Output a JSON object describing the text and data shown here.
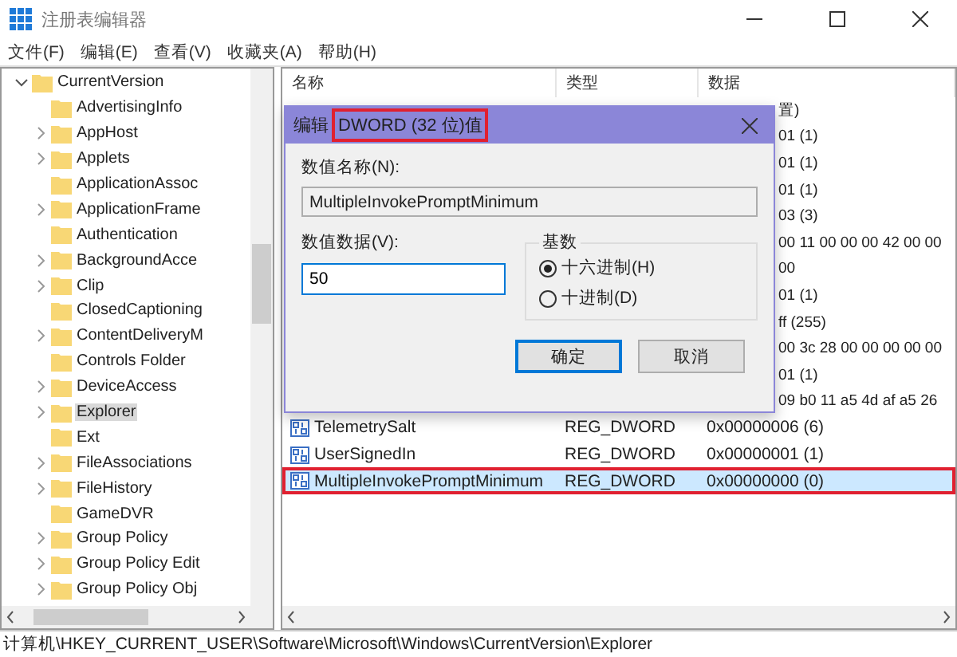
{
  "window": {
    "title": "注册表编辑器"
  },
  "menu": [
    "文件(F)",
    "编辑(E)",
    "查看(V)",
    "收藏夹(A)",
    "帮助(H)"
  ],
  "tree": {
    "label": "CurrentVersion",
    "expanded": true,
    "children": [
      {
        "label": "AdvertisingInfo",
        "has_children": false,
        "selected": false
      },
      {
        "label": "AppHost",
        "has_children": true,
        "selected": false
      },
      {
        "label": "Applets",
        "has_children": true,
        "selected": false
      },
      {
        "label": "ApplicationAssoc",
        "has_children": false,
        "selected": false
      },
      {
        "label": "ApplicationFrame",
        "has_children": true,
        "selected": false
      },
      {
        "label": "Authentication",
        "has_children": false,
        "selected": false
      },
      {
        "label": "BackgroundAcce",
        "has_children": true,
        "selected": false
      },
      {
        "label": "Clip",
        "has_children": true,
        "selected": false
      },
      {
        "label": "ClosedCaptioning",
        "has_children": false,
        "selected": false
      },
      {
        "label": "ContentDeliveryM",
        "has_children": true,
        "selected": false
      },
      {
        "label": "Controls Folder",
        "has_children": false,
        "selected": false
      },
      {
        "label": "DeviceAccess",
        "has_children": true,
        "selected": false
      },
      {
        "label": "Explorer",
        "has_children": true,
        "selected": true
      },
      {
        "label": "Ext",
        "has_children": false,
        "selected": false
      },
      {
        "label": "FileAssociations",
        "has_children": true,
        "selected": false
      },
      {
        "label": "FileHistory",
        "has_children": true,
        "selected": false
      },
      {
        "label": "GameDVR",
        "has_children": false,
        "selected": false
      },
      {
        "label": "Group Policy",
        "has_children": true,
        "selected": false
      },
      {
        "label": "Group Policy Edit",
        "has_children": true,
        "selected": false
      },
      {
        "label": "Group Policy Obj",
        "has_children": true,
        "selected": false
      }
    ]
  },
  "table": {
    "columns": [
      "名称",
      "类型",
      "数据"
    ],
    "rows": [
      {
        "kind": "covered",
        "data": "置)"
      },
      {
        "kind": "covered",
        "data": "01 (1)"
      },
      {
        "kind": "covered",
        "data": "01 (1)"
      },
      {
        "kind": "covered",
        "data": "01 (1)"
      },
      {
        "kind": "covered",
        "data": "03 (3)"
      },
      {
        "kind": "covered",
        "data": "00 11 00 00 00 42 00 00"
      },
      {
        "kind": "covered",
        "data": "00"
      },
      {
        "kind": "covered",
        "data": "01 (1)"
      },
      {
        "kind": "covered",
        "data": "ff (255)"
      },
      {
        "kind": "covered",
        "data": "00 3c 28 00 00 00 00 00"
      },
      {
        "kind": "covered",
        "data": "01 (1)"
      },
      {
        "kind": "covered",
        "data": "09 b0 11 a5 4d af a5 26"
      },
      {
        "kind": "dword",
        "name": "TelemetrySalt",
        "type": "REG_DWORD",
        "data": "0x00000006 (6)",
        "selected": false,
        "highlighted": false
      },
      {
        "kind": "dword",
        "name": "UserSignedIn",
        "type": "REG_DWORD",
        "data": "0x00000001 (1)",
        "selected": false,
        "highlighted": false
      },
      {
        "kind": "dword",
        "name": "MultipleInvokePromptMinimum",
        "type": "REG_DWORD",
        "data": "0x00000000 (0)",
        "selected": true,
        "highlighted": true
      }
    ]
  },
  "dialog": {
    "title_prefix": "编辑",
    "title": "DWORD (32 位)值",
    "title_highlighted": true,
    "name_label": "数值名称(N):",
    "name_value": "MultipleInvokePromptMinimum",
    "data_label": "数值数据(V):",
    "data_value": "50",
    "base_label": "基数",
    "bases": [
      {
        "label": "十六进制(H)",
        "selected": true
      },
      {
        "label": "十进制(D)",
        "selected": false
      }
    ],
    "buttons": [
      {
        "label": "确定",
        "default": true
      },
      {
        "label": "取消",
        "default": false
      }
    ]
  },
  "status_bar": "计算机\\HKEY_CURRENT_USER\\Software\\Microsoft\\Windows\\CurrentVersion\\Explorer"
}
